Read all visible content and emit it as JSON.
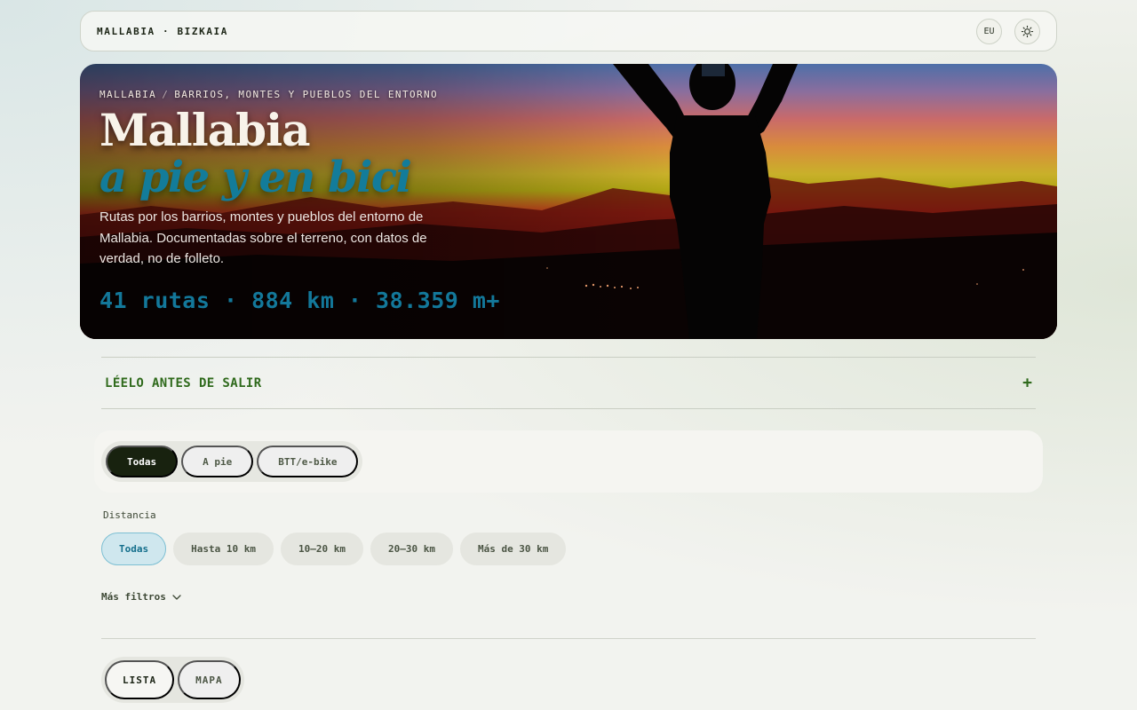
{
  "header": {
    "brand": "MALLABIA · BIZKAIA",
    "lang_button": "EU",
    "theme_icon": "sun-icon"
  },
  "hero": {
    "breadcrumb_home": "MALLABIA",
    "breadcrumb_sep": "/",
    "breadcrumb_section": "BARRIOS, MONTES Y PUEBLOS DEL ENTORNO",
    "title": "Mallabia",
    "subtitle": "a pie y en bici",
    "description": "Rutas por los barrios, montes y pueblos del entorno de Mallabia. Documentadas sobre el terreno, con datos de verdad, no de folleto.",
    "stats": "41 rutas · 884 km · 38.359 m+"
  },
  "notice": {
    "label": "LÉELO ANTES DE SALIR",
    "toggle": "+"
  },
  "type_filter": {
    "options": [
      "Todas",
      "A pie",
      "BTT/e-bike"
    ],
    "selected": "Todas"
  },
  "distance_filter": {
    "label": "Distancia",
    "options": [
      "Todas",
      "Hasta 10 km",
      "10–20 km",
      "20–30 km",
      "Más de 30 km"
    ],
    "selected": "Todas"
  },
  "more_filters": {
    "label": "Más filtros",
    "icon": "chevron-down-icon"
  },
  "view_toggle": {
    "options": [
      "LISTA",
      "MAPA"
    ],
    "selected": "LISTA"
  },
  "colors": {
    "accent_teal": "#137c9a",
    "accent_green": "#2f6a1c",
    "dark_pill": "#18220f"
  }
}
